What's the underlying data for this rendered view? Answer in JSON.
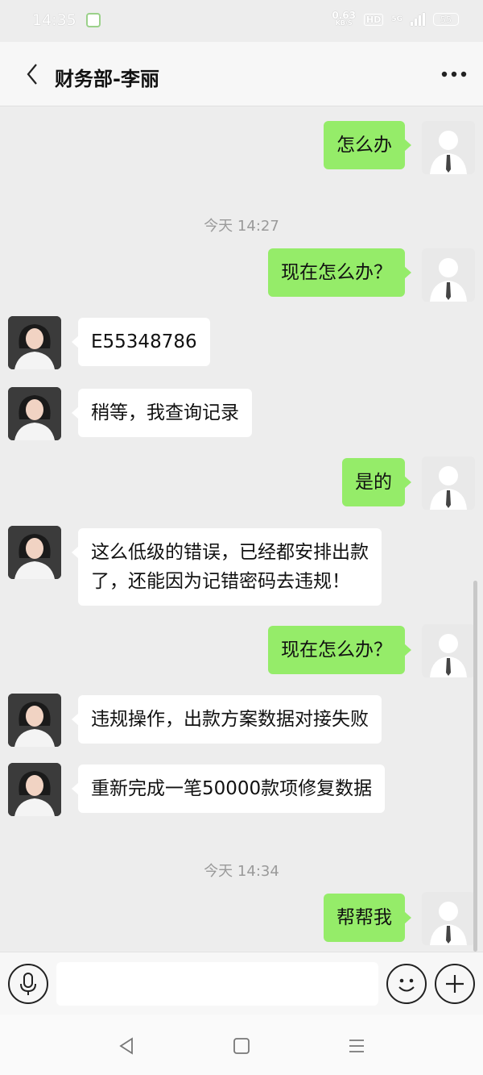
{
  "status_bar": {
    "time": "14:35",
    "speed_value": "0.63",
    "speed_unit": "KB/S",
    "hd_label": "HD",
    "network_label": "5G",
    "battery": "55"
  },
  "header": {
    "title": "财务部-李丽",
    "back_icon": "chevron-left-icon",
    "more_icon": "more-horizontal-icon"
  },
  "messages": [
    {
      "sender": "me",
      "text": "怎么办"
    },
    {
      "type": "time",
      "text": "今天 14:27"
    },
    {
      "sender": "me",
      "text": "现在怎么办？"
    },
    {
      "sender": "them",
      "text": "E55348786"
    },
    {
      "sender": "them",
      "text": "稍等，我查询记录"
    },
    {
      "sender": "me",
      "text": "是的"
    },
    {
      "sender": "them",
      "line1": "这么低级的错误，已经都安排出款",
      "line2": "了，还能因为记错密码去违规！"
    },
    {
      "sender": "me",
      "text": "现在怎么办？"
    },
    {
      "sender": "them",
      "text": "违规操作，出款方案数据对接失败"
    },
    {
      "sender": "them",
      "text": "重新完成一笔50000款项修复数据"
    },
    {
      "type": "time",
      "text": "今天 14:34"
    },
    {
      "sender": "me",
      "text": "帮帮我"
    }
  ],
  "input_bar": {
    "input_value": "",
    "voice_icon": "microphone-icon",
    "emoji_icon": "emoji-icon",
    "plus_icon": "plus-icon"
  },
  "nav_bar": {
    "back_icon": "nav-back-icon",
    "home_icon": "nav-home-icon",
    "menu_icon": "nav-menu-icon"
  },
  "colors": {
    "my_bubble": "#95ec69",
    "their_bubble": "#ffffff",
    "background": "#ededed"
  }
}
